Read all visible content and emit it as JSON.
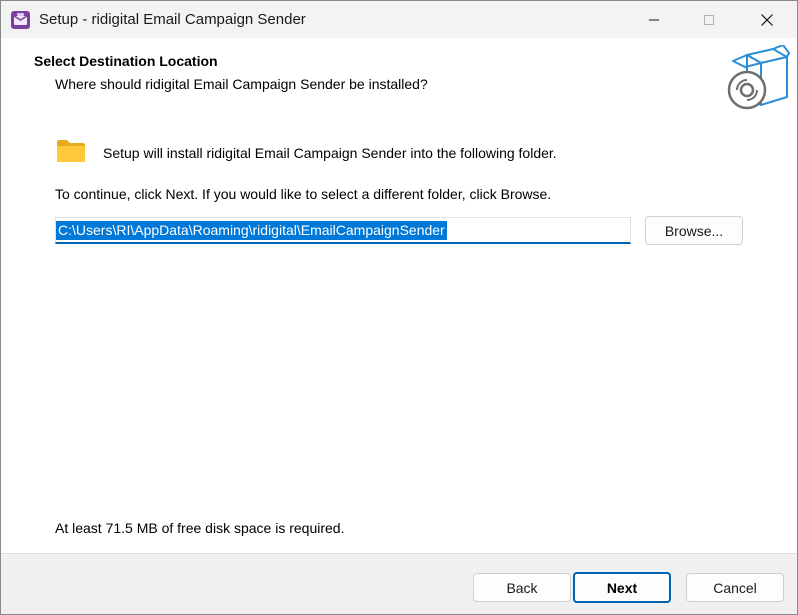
{
  "window": {
    "title": "Setup - ridigital Email Campaign Sender"
  },
  "header": {
    "title": "Select Destination Location",
    "subtitle": "Where should ridigital Email Campaign Sender be installed?"
  },
  "body": {
    "install_text": "Setup will install ridigital Email Campaign Sender into the following folder.",
    "continue_text": "To continue, click Next. If you would like to select a different folder, click Browse.",
    "path_value": "C:\\Users\\RI\\AppData\\Roaming\\ridigital\\EmailCampaignSender",
    "browse_label": "Browse...",
    "disk_space_text": "At least 71.5 MB of free disk space is required."
  },
  "footer": {
    "back_label": "Back",
    "next_label": "Next",
    "cancel_label": "Cancel"
  },
  "colors": {
    "accent": "#0078d7",
    "accent_border": "#0063b1",
    "titlebar_bg": "#f3f3f3",
    "footer_bg": "#f0f0f0",
    "folder_yellow": "#ffc83d"
  },
  "icons": {
    "app": "installer-app-icon",
    "folder": "folder-icon",
    "header_graphic": "software-box-cd-icon"
  }
}
